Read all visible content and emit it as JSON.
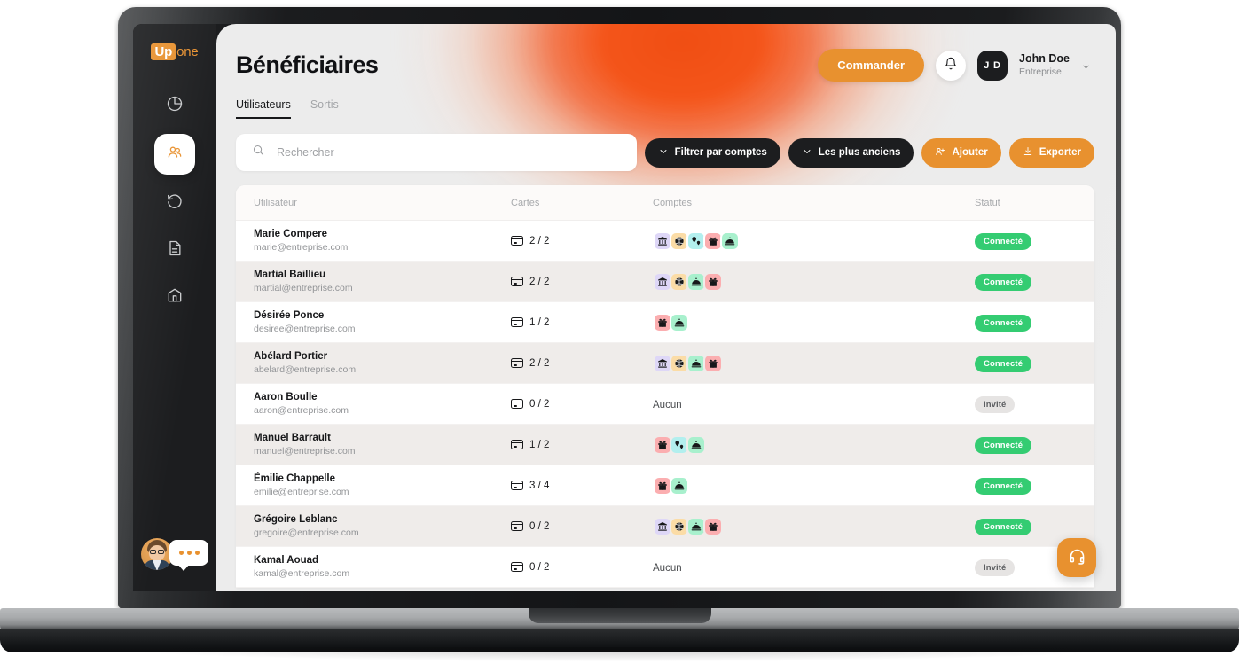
{
  "brand": {
    "logo_badge": "Up",
    "logo_tail": "one",
    "accent": "#e8912f"
  },
  "sidebar": {
    "items": [
      {
        "name": "analytics",
        "icon": "pie-chart-icon",
        "active": false
      },
      {
        "name": "beneficiaries",
        "icon": "users-icon",
        "active": true
      },
      {
        "name": "history",
        "icon": "history-icon",
        "active": false
      },
      {
        "name": "documents",
        "icon": "document-icon",
        "active": false
      },
      {
        "name": "company",
        "icon": "building-icon",
        "active": false
      }
    ],
    "chat_widget": {
      "icon": "chat-bubble-icon",
      "dots": 3
    }
  },
  "header": {
    "title": "Bénéficiaires",
    "order_button": "Commander",
    "notifications_icon": "bell-icon",
    "user": {
      "initials": "J D",
      "name": "John Doe",
      "org": "Entreprise"
    }
  },
  "tabs": [
    {
      "label": "Utilisateurs",
      "active": true
    },
    {
      "label": "Sortis",
      "active": false
    }
  ],
  "toolbar": {
    "search_placeholder": "Rechercher",
    "search_value": "",
    "search_icon": "search-icon",
    "filter_button": "Filtrer par comptes",
    "sort_button": "Les plus anciens",
    "add_button": "Ajouter",
    "export_button": "Exporter"
  },
  "table": {
    "columns": [
      "Utilisateur",
      "Cartes",
      "Comptes",
      "Statut"
    ],
    "no_accounts_label": "Aucun",
    "rows": [
      {
        "name": "Marie Compere",
        "email": "marie@entreprise.com",
        "cards": "2 / 2",
        "accounts": [
          "bank",
          "sport",
          "travel",
          "gift",
          "meal"
        ],
        "status": "Connecté",
        "status_type": "connected"
      },
      {
        "name": "Martial Baillieu",
        "email": "martial@entreprise.com",
        "cards": "2 / 2",
        "accounts": [
          "bank",
          "sport",
          "meal",
          "gift"
        ],
        "status": "Connecté",
        "status_type": "connected"
      },
      {
        "name": "Désirée Ponce",
        "email": "desiree@entreprise.com",
        "cards": "1 / 2",
        "accounts": [
          "gift",
          "meal"
        ],
        "status": "Connecté",
        "status_type": "connected"
      },
      {
        "name": "Abélard Portier",
        "email": "abelard@entreprise.com",
        "cards": "2 / 2",
        "accounts": [
          "bank",
          "sport",
          "meal",
          "gift"
        ],
        "status": "Connecté",
        "status_type": "connected"
      },
      {
        "name": "Aaron Boulle",
        "email": "aaron@entreprise.com",
        "cards": "0 / 2",
        "accounts": [],
        "status": "Invité",
        "status_type": "invited"
      },
      {
        "name": "Manuel Barrault",
        "email": "manuel@entreprise.com",
        "cards": "1 / 2",
        "accounts": [
          "gift",
          "travel",
          "meal"
        ],
        "status": "Connecté",
        "status_type": "connected"
      },
      {
        "name": "Émilie Chappelle",
        "email": "emilie@entreprise.com",
        "cards": "3 / 4",
        "accounts": [
          "gift",
          "meal"
        ],
        "status": "Connecté",
        "status_type": "connected"
      },
      {
        "name": "Grégoire Leblanc",
        "email": "gregoire@entreprise.com",
        "cards": "0 / 2",
        "accounts": [
          "bank",
          "sport",
          "meal",
          "gift"
        ],
        "status": "Connecté",
        "status_type": "connected"
      },
      {
        "name": "Kamal Aouad",
        "email": "kamal@entreprise.com",
        "cards": "0 / 2",
        "accounts": [],
        "status": "Invité",
        "status_type": "invited"
      }
    ]
  },
  "account_types": {
    "bank": {
      "label": "bank-icon",
      "bg": "#ded7f7"
    },
    "sport": {
      "label": "sport-icon",
      "bg": "#fbdca6"
    },
    "travel": {
      "label": "location-pin-icon",
      "bg": "#b2efee"
    },
    "gift": {
      "label": "gift-icon",
      "bg": "#fbaeb0"
    },
    "meal": {
      "label": "meal-cover-icon",
      "bg": "#a8f0cd"
    }
  },
  "support": {
    "icon": "headset-icon"
  }
}
